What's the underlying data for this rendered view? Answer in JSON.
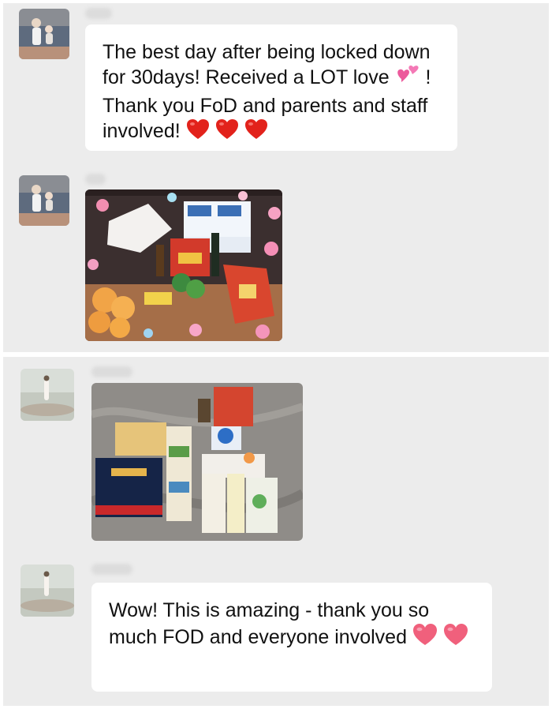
{
  "messages": [
    {
      "text_parts": [
        "The best day after being locked down for 30days! Received a LOT love ",
        " ! Thank you FoD and parents and staff involved! "
      ]
    },
    {
      "image": "photo-food-package-pink-decorations"
    },
    {
      "image": "photo-food-package-marble-floor"
    },
    {
      "text_parts": [
        "Wow! This is amazing - thank you so much FOD and everyone involved "
      ]
    }
  ],
  "icons": {
    "two_hearts": "two-hearts-emoji",
    "red_heart": "red-heart-emoji",
    "pink_heart": "pink-heart-emoji"
  },
  "colors": {
    "chat_background": "#ececec",
    "bubble": "#ffffff",
    "red_heart": "#e2221b",
    "pink_heart": "#f0607c"
  }
}
